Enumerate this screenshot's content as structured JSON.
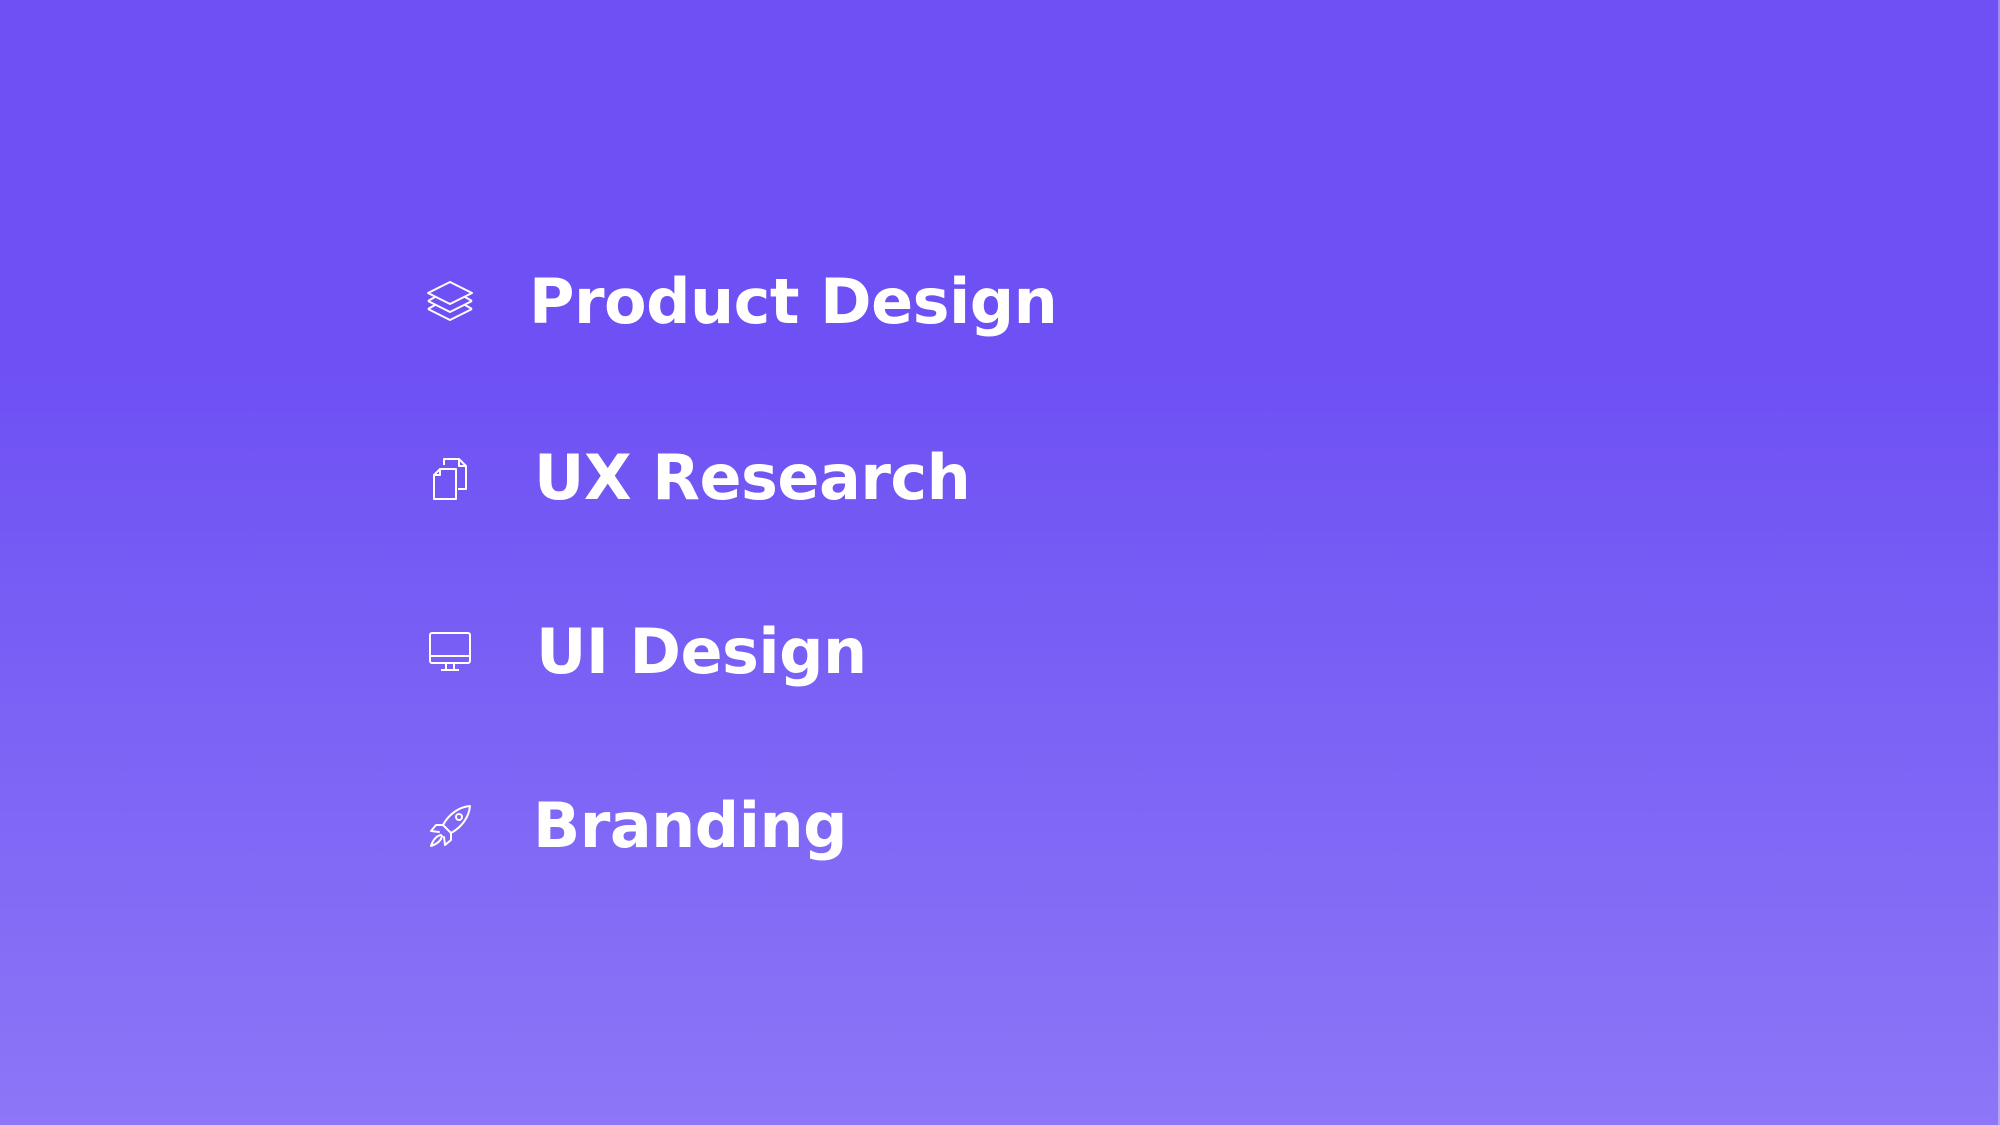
{
  "background": {
    "top_color": "#6e50f4",
    "bottom_color": "#8d76f7"
  },
  "services": [
    {
      "label": "Product Design",
      "icon": "layers-icon"
    },
    {
      "label": "UX Research",
      "icon": "documents-icon"
    },
    {
      "label": "UI Design",
      "icon": "monitor-icon"
    },
    {
      "label": "Branding",
      "icon": "rocket-icon"
    }
  ]
}
